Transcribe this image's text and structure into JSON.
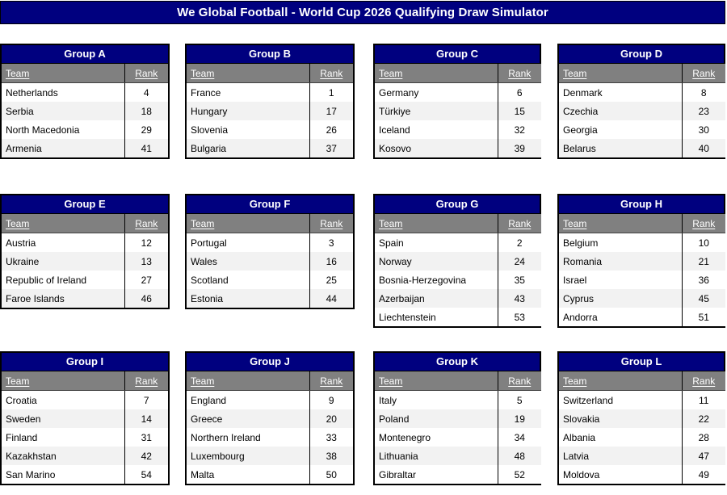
{
  "header": {
    "title": "We Global Football - World Cup 2026 Qualifying Draw Simulator",
    "background_color": "#00007F",
    "text_color": "#FFFFFF"
  },
  "table_columns": {
    "team_label": "Team",
    "rank_label": "Rank"
  },
  "colors": {
    "group_header_bg": "#00007F",
    "column_header_bg": "#808080",
    "row_alt_bg": "#F2F2F2",
    "row_bg": "#FFFFFF",
    "border": "#000000"
  },
  "groups": [
    {
      "name": "Group A",
      "teams": [
        {
          "team": "Netherlands",
          "rank": "4"
        },
        {
          "team": "Serbia",
          "rank": "18"
        },
        {
          "team": "North Macedonia",
          "rank": "29"
        },
        {
          "team": "Armenia",
          "rank": "41"
        }
      ]
    },
    {
      "name": "Group B",
      "teams": [
        {
          "team": "France",
          "rank": "1"
        },
        {
          "team": "Hungary",
          "rank": "17"
        },
        {
          "team": "Slovenia",
          "rank": "26"
        },
        {
          "team": "Bulgaria",
          "rank": "37"
        }
      ]
    },
    {
      "name": "Group C",
      "teams": [
        {
          "team": "Germany",
          "rank": "6"
        },
        {
          "team": "Türkiye",
          "rank": "15"
        },
        {
          "team": "Iceland",
          "rank": "32"
        },
        {
          "team": "Kosovo",
          "rank": "39"
        }
      ]
    },
    {
      "name": "Group D",
      "teams": [
        {
          "team": "Denmark",
          "rank": "8"
        },
        {
          "team": "Czechia",
          "rank": "23"
        },
        {
          "team": "Georgia",
          "rank": "30"
        },
        {
          "team": "Belarus",
          "rank": "40"
        }
      ]
    },
    {
      "name": "Group E",
      "teams": [
        {
          "team": "Austria",
          "rank": "12"
        },
        {
          "team": "Ukraine",
          "rank": "13"
        },
        {
          "team": "Republic of Ireland",
          "rank": "27"
        },
        {
          "team": "Faroe Islands",
          "rank": "46"
        }
      ]
    },
    {
      "name": "Group F",
      "teams": [
        {
          "team": "Portugal",
          "rank": "3"
        },
        {
          "team": "Wales",
          "rank": "16"
        },
        {
          "team": "Scotland",
          "rank": "25"
        },
        {
          "team": "Estonia",
          "rank": "44"
        }
      ]
    },
    {
      "name": "Group G",
      "teams": [
        {
          "team": "Spain",
          "rank": "2"
        },
        {
          "team": "Norway",
          "rank": "24"
        },
        {
          "team": "Bosnia-Herzegovina",
          "rank": "35"
        },
        {
          "team": "Azerbaijan",
          "rank": "43"
        },
        {
          "team": "Liechtenstein",
          "rank": "53"
        }
      ]
    },
    {
      "name": "Group H",
      "teams": [
        {
          "team": "Belgium",
          "rank": "10"
        },
        {
          "team": "Romania",
          "rank": "21"
        },
        {
          "team": "Israel",
          "rank": "36"
        },
        {
          "team": "Cyprus",
          "rank": "45"
        },
        {
          "team": "Andorra",
          "rank": "51"
        }
      ]
    },
    {
      "name": "Group I",
      "teams": [
        {
          "team": "Croatia",
          "rank": "7"
        },
        {
          "team": "Sweden",
          "rank": "14"
        },
        {
          "team": "Finland",
          "rank": "31"
        },
        {
          "team": "Kazakhstan",
          "rank": "42"
        },
        {
          "team": "San Marino",
          "rank": "54"
        }
      ]
    },
    {
      "name": "Group J",
      "teams": [
        {
          "team": "England",
          "rank": "9"
        },
        {
          "team": "Greece",
          "rank": "20"
        },
        {
          "team": "Northern Ireland",
          "rank": "33"
        },
        {
          "team": "Luxembourg",
          "rank": "38"
        },
        {
          "team": "Malta",
          "rank": "50"
        }
      ]
    },
    {
      "name": "Group K",
      "teams": [
        {
          "team": "Italy",
          "rank": "5"
        },
        {
          "team": "Poland",
          "rank": "19"
        },
        {
          "team": "Montenegro",
          "rank": "34"
        },
        {
          "team": "Lithuania",
          "rank": "48"
        },
        {
          "team": "Gibraltar",
          "rank": "52"
        }
      ]
    },
    {
      "name": "Group L",
      "teams": [
        {
          "team": "Switzerland",
          "rank": "11"
        },
        {
          "team": "Slovakia",
          "rank": "22"
        },
        {
          "team": "Albania",
          "rank": "28"
        },
        {
          "team": "Latvia",
          "rank": "47"
        },
        {
          "team": "Moldova",
          "rank": "49"
        }
      ]
    }
  ]
}
